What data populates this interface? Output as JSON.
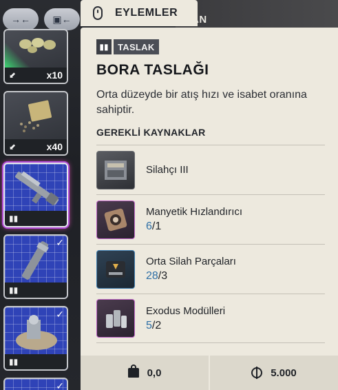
{
  "background": {
    "partial_header_text": "AN"
  },
  "top_buttons": [
    {
      "icon": "collapse-arrows-icon",
      "glyph": "→←"
    },
    {
      "icon": "sort-arrow-icon",
      "glyph": "▣←"
    }
  ],
  "inventory": [
    {
      "icon": "seeds-icon",
      "quantity": "x10",
      "rarity_color": "#3df07a"
    },
    {
      "icon": "seed-packet-icon",
      "quantity": "x40"
    },
    {
      "icon": "rifle-blueprint-icon",
      "selected": true
    },
    {
      "icon": "barrel-blueprint-icon",
      "checked": true
    },
    {
      "icon": "device-blueprint-icon",
      "checked": true
    }
  ],
  "panel": {
    "tab_label": "EYLEMLER",
    "badge": "TASLAK",
    "title": "BORA TASLAĞI",
    "description": "Orta düzeyde bir atış hızı ve isabet oranına sahiptir.",
    "requirements_header": "GEREKLİ KAYNAKLAR",
    "requirements": [
      {
        "name": "Silahçı III",
        "have": "",
        "need": "",
        "thumb": "gray",
        "icon": "workbench-icon"
      },
      {
        "name": "Manyetik Hızlandırıcı",
        "have": "6",
        "need": "1",
        "thumb": "pink",
        "icon": "magnetic-accelerator-icon"
      },
      {
        "name": "Orta Silah Parçaları",
        "have": "28",
        "need": "3",
        "thumb": "blue",
        "icon": "weapon-parts-case-icon"
      },
      {
        "name": "Exodus Modülleri",
        "have": "5",
        "need": "2",
        "thumb": "pink",
        "icon": "exodus-modules-icon"
      }
    ],
    "footer": {
      "weight": "0,0",
      "price": "5.000"
    }
  },
  "colors": {
    "panel_bg": "#ede9de",
    "have_count": "#2e6fa6",
    "blueprint_bg": "#2f43b7",
    "selected_glow": "#ff5ac8"
  }
}
